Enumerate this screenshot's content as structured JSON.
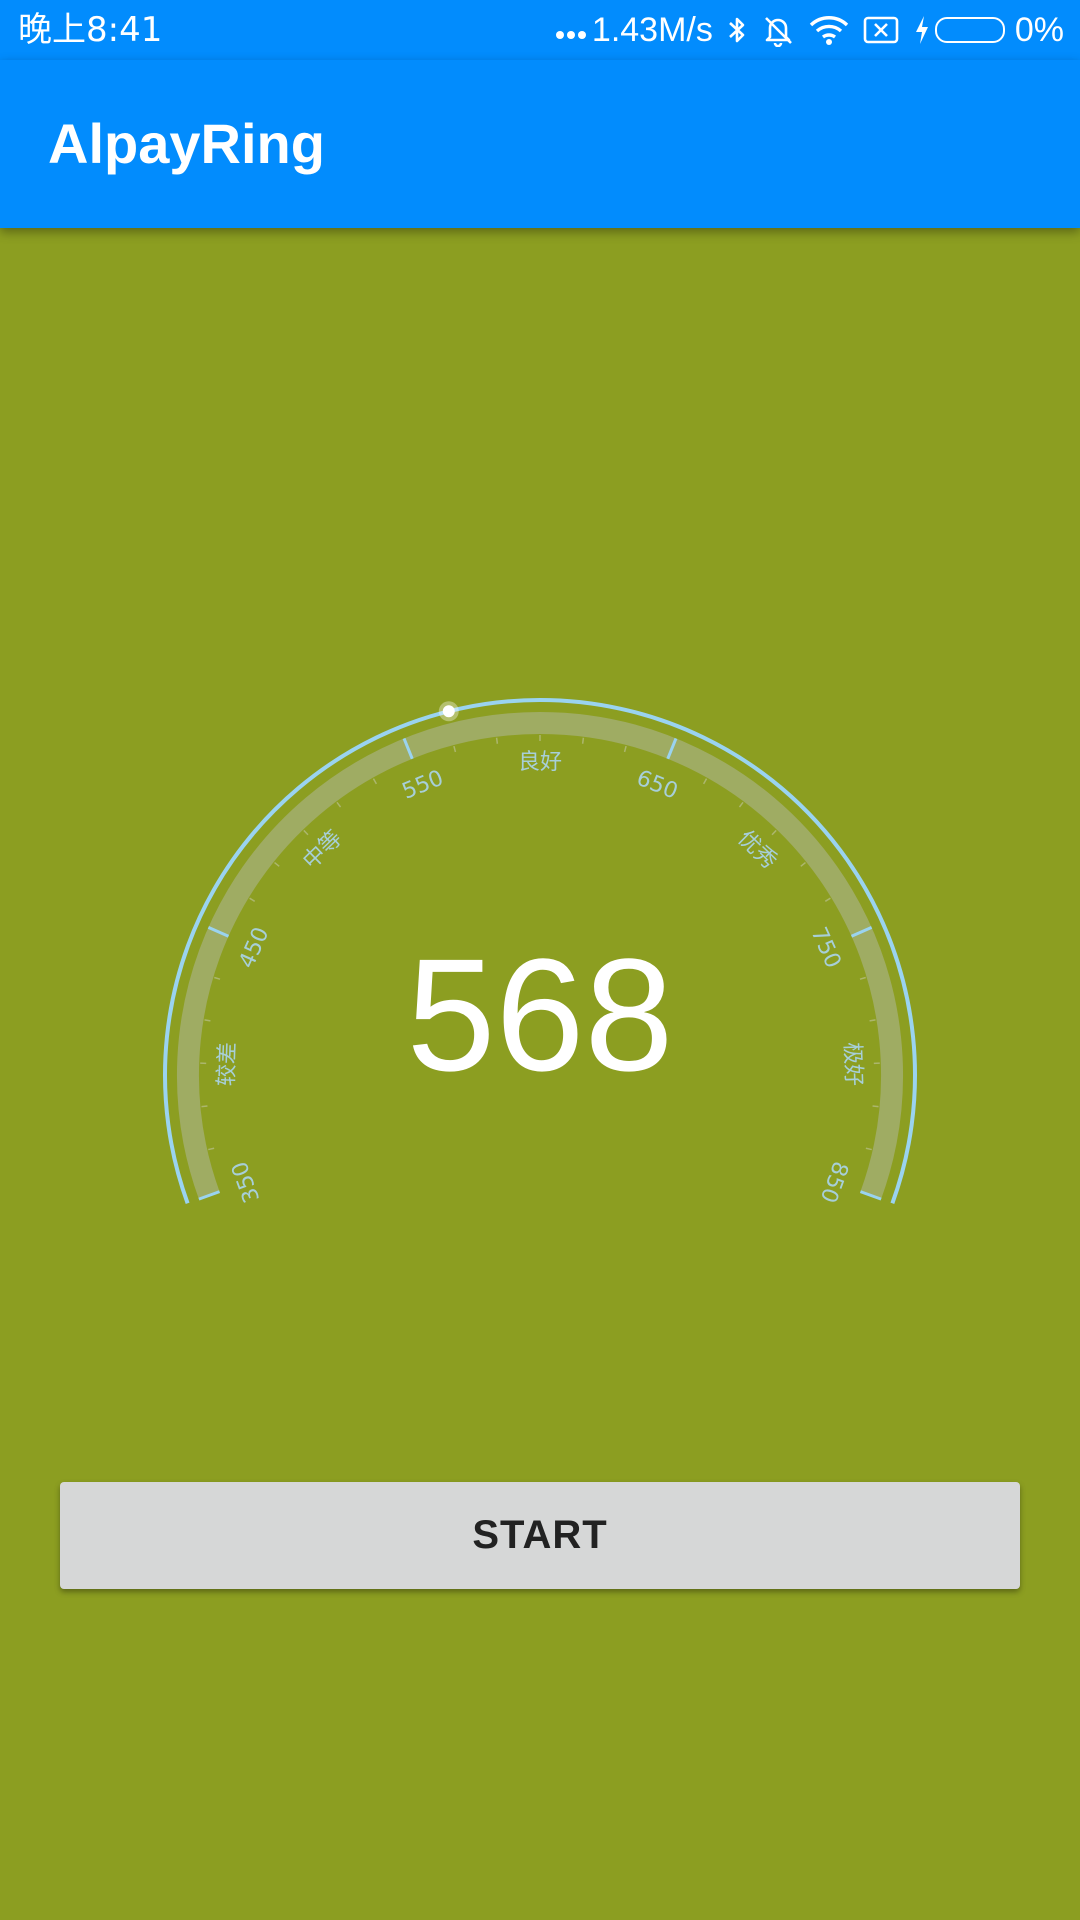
{
  "status_bar": {
    "time": "晚上8:41",
    "net_speed": "1.43M/s",
    "battery_percent": "0%",
    "icons": [
      "bluetooth-icon",
      "mute-icon",
      "wifi-icon",
      "sim-icon",
      "charging-icon",
      "battery-icon"
    ]
  },
  "app_bar": {
    "title": "AlpayRing"
  },
  "gauge": {
    "score": "568",
    "min": 350,
    "max": 850,
    "value": 568,
    "number_labels": [
      "350",
      "450",
      "550",
      "650",
      "750",
      "850"
    ],
    "grade_labels": [
      "较差",
      "中等",
      "良好",
      "优秀",
      "极好"
    ],
    "colors": {
      "outer_arc": "#9ad3f0",
      "band": "#a2ae6e",
      "label": "#a7cfd8",
      "indicator": "#ffffff"
    }
  },
  "actions": {
    "start_label": "START"
  },
  "theme": {
    "primary": "#028cfd",
    "background": "#8c9e21",
    "button": "#d6d7d7"
  }
}
